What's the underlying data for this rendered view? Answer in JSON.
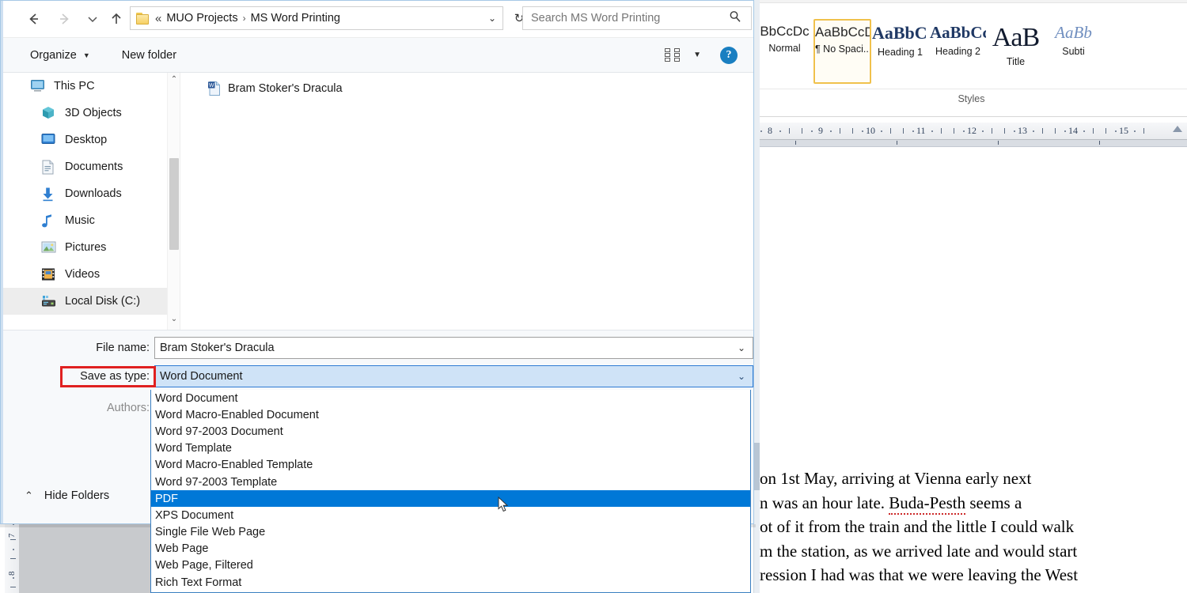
{
  "dialog": {
    "nav": {
      "back_label": "Back",
      "forward_label": "Forward",
      "recent_label": "Recent locations",
      "up_label": "Up one level"
    },
    "address": {
      "lead": "«",
      "crumbs": [
        "MUO Projects",
        "MS Word Printing"
      ],
      "separator": "›",
      "caret": "⌄",
      "refresh": "↻"
    },
    "search": {
      "placeholder": "Search MS Word Printing"
    },
    "toolbar": {
      "organize": "Organize",
      "organize_caret": "▼",
      "new_folder": "New folder",
      "view_caret": "▼",
      "help": "?"
    },
    "sidebar": {
      "items": [
        {
          "label": "This PC",
          "icon": "monitor-icon",
          "indent": false,
          "selected": false
        },
        {
          "label": "3D Objects",
          "icon": "cube-icon",
          "indent": true,
          "selected": false
        },
        {
          "label": "Desktop",
          "icon": "desktop-icon",
          "indent": true,
          "selected": false
        },
        {
          "label": "Documents",
          "icon": "documents-icon",
          "indent": true,
          "selected": false
        },
        {
          "label": "Downloads",
          "icon": "download-arrow-icon",
          "indent": true,
          "selected": false
        },
        {
          "label": "Music",
          "icon": "music-note-icon",
          "indent": true,
          "selected": false
        },
        {
          "label": "Pictures",
          "icon": "picture-icon",
          "indent": true,
          "selected": false
        },
        {
          "label": "Videos",
          "icon": "film-icon",
          "indent": true,
          "selected": false
        },
        {
          "label": "Local Disk (C:)",
          "icon": "hard-disk-icon",
          "indent": true,
          "selected": true
        }
      ],
      "scroll_up": "⌃",
      "scroll_down": "⌄"
    },
    "files": [
      {
        "name": "Bram Stoker's Dracula",
        "icon": "word-document-icon"
      }
    ],
    "fields": {
      "filename_label": "File name:",
      "filename_value": "Bram Stoker's Dracula",
      "filename_caret": "⌄",
      "savetype_label": "Save as type:",
      "savetype_value": "Word Document",
      "savetype_caret": "⌄",
      "authors_label": "Authors:"
    },
    "hide_folders": {
      "chevron": "⌃",
      "label": "Hide Folders"
    },
    "savetype_options": [
      {
        "label": "Word Document",
        "selected": false
      },
      {
        "label": "Word Macro-Enabled Document",
        "selected": false
      },
      {
        "label": "Word 97-2003 Document",
        "selected": false
      },
      {
        "label": "Word Template",
        "selected": false
      },
      {
        "label": "Word Macro-Enabled Template",
        "selected": false
      },
      {
        "label": "Word 97-2003 Template",
        "selected": false
      },
      {
        "label": "PDF",
        "selected": true
      },
      {
        "label": "XPS Document",
        "selected": false
      },
      {
        "label": "Single File Web Page",
        "selected": false
      },
      {
        "label": "Web Page",
        "selected": false
      },
      {
        "label": "Web Page, Filtered",
        "selected": false
      },
      {
        "label": "Rich Text Format",
        "selected": false
      }
    ],
    "annotation": {
      "highlight_color": "#e02020",
      "highlight_target": "Save as type:"
    },
    "colors": {
      "selection_blue": "#0078d7",
      "combo_fill": "#cfe3f7",
      "combo_border": "#2e7bd4",
      "window_border": "#a6c8e6"
    }
  },
  "word": {
    "styles_group_label": "Styles",
    "styles": [
      {
        "preview": "BbCcDc",
        "name": "Normal",
        "selected": false,
        "kind": "normal"
      },
      {
        "preview": "AaBbCcDc",
        "name": "¶ No Spaci...",
        "selected": true,
        "kind": "nospace"
      },
      {
        "preview": "AaBbC‹",
        "name": "Heading 1",
        "selected": false,
        "kind": "h1"
      },
      {
        "preview": "AaBbCc",
        "name": "Heading 2",
        "selected": false,
        "kind": "h2"
      },
      {
        "preview": "AaB",
        "name": "Title",
        "selected": false,
        "kind": "title"
      },
      {
        "preview": "AaBb",
        "name": "Subti",
        "selected": false,
        "kind": "subtitle"
      }
    ],
    "ruler": {
      "ticks": [
        "8",
        "9",
        "10",
        "11",
        "12",
        "13",
        "14",
        "15"
      ]
    },
    "document_lines": [
      "on 1st May, arriving at Vienna early next",
      "n was an hour late. Buda-Pesth seems a",
      "ot of it from the train and the little I could walk",
      "m the station, as we arrived late and would start",
      "ression I had was that we were leaving the West"
    ],
    "misspelled_word": "Buda-Pesth"
  }
}
